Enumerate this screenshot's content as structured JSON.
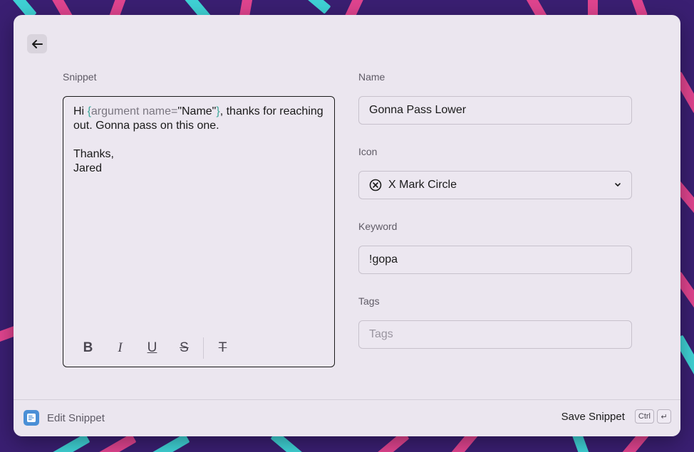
{
  "colors": {
    "background": "#3a1f72",
    "stripe_pink": "#e0448f",
    "stripe_cyan": "#3fd2d5",
    "window": "#ebe6ef",
    "argument_brace": "#3aa89a",
    "footer_icon": "#4a8fd6"
  },
  "header": {
    "back_icon": "arrow-left-icon"
  },
  "snippet": {
    "label": "Snippet",
    "line1_start": "Hi ",
    "arg_open": "{",
    "arg_text": "argument name=",
    "arg_value": "\"Name\"",
    "arg_close": "}",
    "line1_end": ", thanks for reaching out. Gonna pass on this one.",
    "line3": "Thanks,",
    "line4": "Jared",
    "toolbar": {
      "bold": "B",
      "italic": "I",
      "underline": "U",
      "strikethrough": "S",
      "clear_format": "T"
    }
  },
  "name": {
    "label": "Name",
    "value": "Gonna Pass Lower"
  },
  "icon": {
    "label": "Icon",
    "value": "X Mark Circle",
    "icon": "x-mark-circle-icon"
  },
  "keyword": {
    "label": "Keyword",
    "value": "!gopa"
  },
  "tags": {
    "label": "Tags",
    "placeholder": "Tags"
  },
  "footer": {
    "title": "Edit Snippet",
    "action_label": "Save Snippet",
    "shortcut_key1": "Ctrl",
    "shortcut_key2": "↵"
  }
}
